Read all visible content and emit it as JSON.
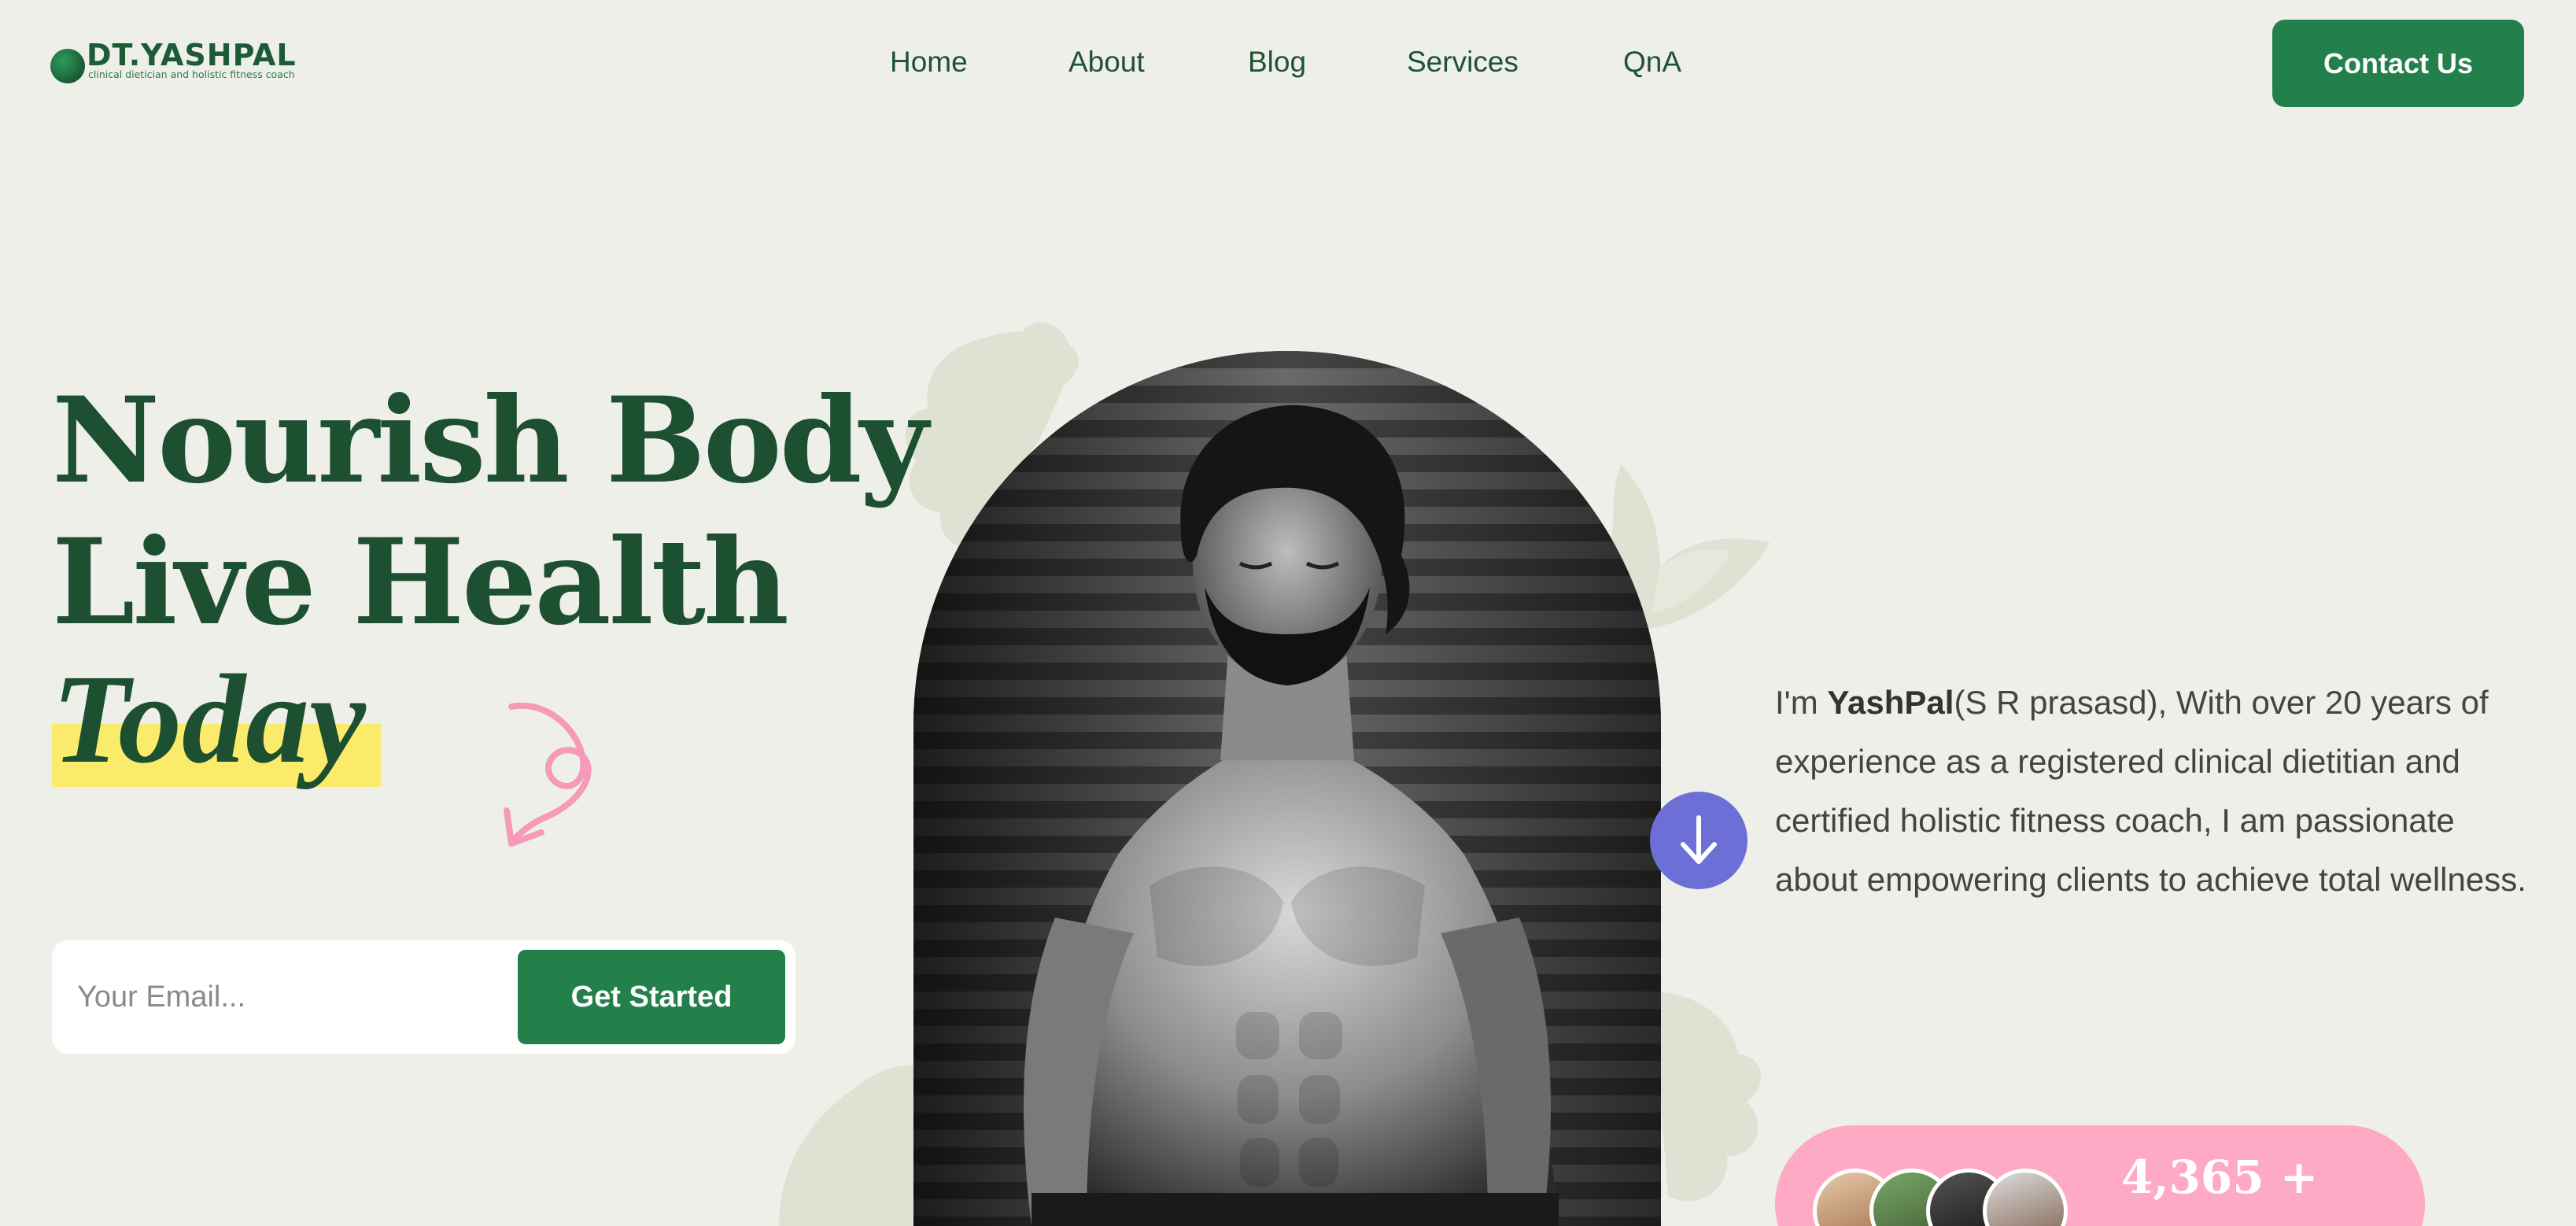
{
  "brand": {
    "name": "DT.YASHPAL",
    "tagline": "clinical dietician and holistic fitness coach",
    "logo_icon": "green-sphere"
  },
  "nav": {
    "items": [
      {
        "label": "Home"
      },
      {
        "label": "About"
      },
      {
        "label": "Blog"
      },
      {
        "label": "Services"
      },
      {
        "label": "QnA"
      }
    ],
    "contact_label": "Contact Us"
  },
  "hero": {
    "line1": "Nourish Body",
    "line2": "Live Health",
    "line3": "Today",
    "email_placeholder": "Your Email...",
    "cta_label": "Get Started"
  },
  "bio": {
    "intro": "I'm ",
    "name": "YashPal",
    "text": "(S R prasasd), With over 20 years of experience as a registered clinical dietitian and certified holistic fitness coach, I am passionate about empowering clients to achieve total wellness."
  },
  "stats": {
    "count": "4,365 +"
  },
  "icons": {
    "scroll": "arrow-down-icon",
    "swirl": "swirl-arrow-icon"
  },
  "colors": {
    "background": "#efefea",
    "brand_green": "#23804b",
    "heading_green": "#1d4f31",
    "highlight_yellow": "#fbeb6b",
    "pink": "#ffaac4",
    "scroll_purple": "#6c70d6"
  }
}
